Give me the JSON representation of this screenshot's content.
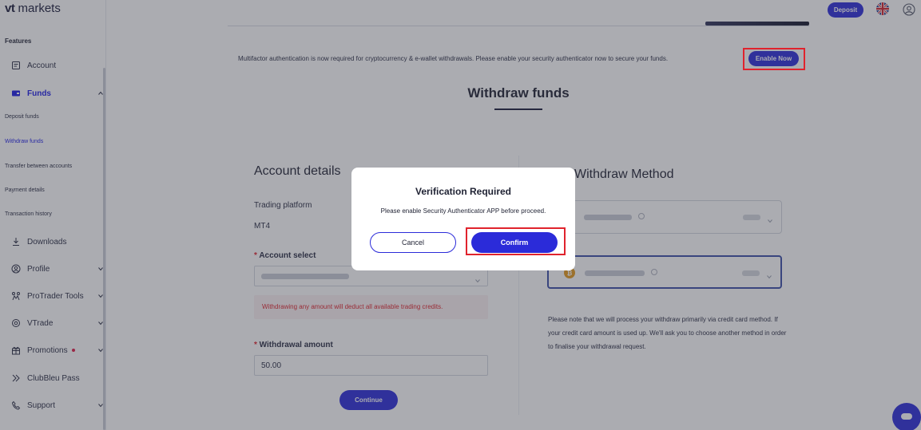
{
  "brand": {
    "logo_bold": "vt",
    "logo_rest": " markets"
  },
  "sidebar": {
    "section_label": "Features",
    "items": {
      "account": "Account",
      "funds": "Funds",
      "downloads": "Downloads",
      "profile": "Profile",
      "protrader": "ProTrader Tools",
      "vtrade": "VTrade",
      "promotions": "Promotions",
      "clubbleu": "ClubBleu Pass",
      "support": "Support"
    },
    "funds_sub": {
      "deposit": "Deposit funds",
      "withdraw": "Withdraw funds",
      "transfer": "Transfer between accounts",
      "payment": "Payment details",
      "history": "Transaction history"
    },
    "active_sub": "Withdraw funds"
  },
  "topbar": {
    "deposit_label": "Deposit",
    "language_flag": "uk-flag-icon",
    "user_icon": "user-circle-icon"
  },
  "banner": {
    "notice": "Multifactor authentication is now required for cryptocurrency & e-wallet withdrawals. Please enable your security authenticator now to secure your funds.",
    "enable_label": "Enable Now"
  },
  "page": {
    "title": "Withdraw funds",
    "account_details": {
      "heading": "Account details",
      "platform_label": "Trading platform",
      "platform_value": "MT4",
      "account_select_label": "Account select",
      "warning": "Withdrawing any amount will deduct all available trading credits.",
      "amount_label": "Withdrawal amount",
      "amount_value": "50.00",
      "continue_label": "Continue"
    },
    "withdraw_method": {
      "heading": "Withdraw Method",
      "note": "Please note that we will process your withdraw primarily via credit card method. If your credit card amount is used up. We'll ask you to choose another method in order to finalise your withdrawal request."
    }
  },
  "modal": {
    "title": "Verification Required",
    "message": "Please enable Security Authenticator APP before proceed.",
    "cancel_label": "Cancel",
    "confirm_label": "Confirm"
  },
  "colors": {
    "accent": "#2b2bd9",
    "highlight": "#e0232d",
    "warning_text": "#e0232d"
  }
}
